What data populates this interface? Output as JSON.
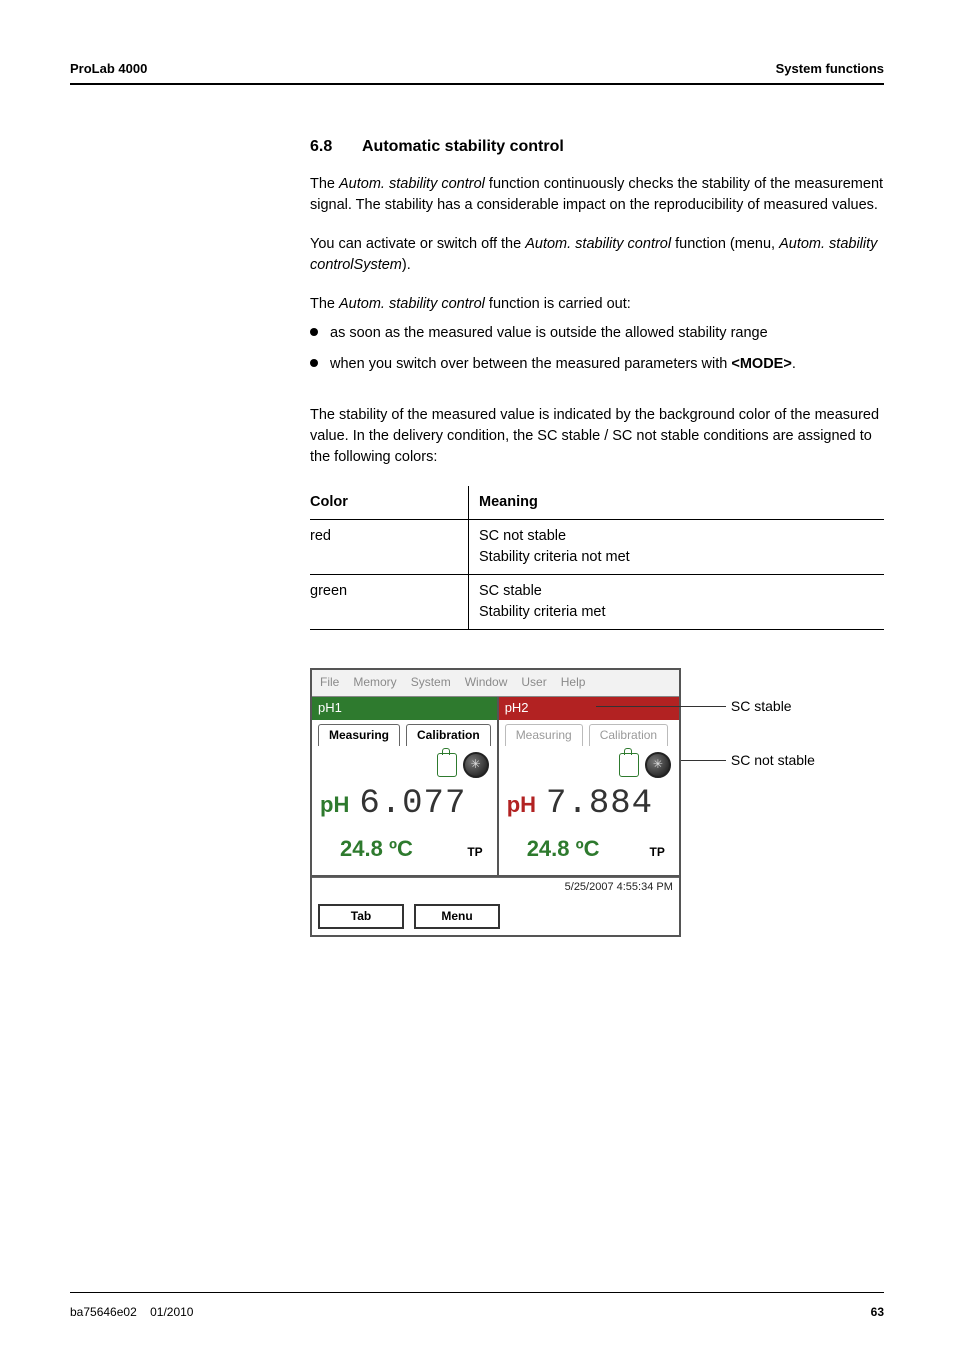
{
  "header": {
    "left": "ProLab 4000",
    "right": "System functions"
  },
  "section": {
    "number": "6.8",
    "title": "Automatic stability control"
  },
  "paragraphs": {
    "p1_a": "The ",
    "p1_b": "Autom. stability control",
    "p1_c": " function continuously checks the stability of the measurement signal. The stability has a considerable impact on the reproducibility of measured values.",
    "p2_a": "You can activate or switch off the ",
    "p2_b": "Autom. stability control",
    "p2_c": " function (menu, ",
    "p2_d": "Autom. stability controlSystem",
    "p2_e": ").",
    "p3_a": "The ",
    "p3_b": "Autom. stability control",
    "p3_c": " function is carried out:",
    "p4": "The stability of the measured value is indicated by the background color of the measured value. In the delivery condition, the SC stable / SC not stable conditions are assigned to the following colors:"
  },
  "bullets": {
    "b1": "as soon as the measured value is outside the allowed stability range",
    "b2_a": "when you switch over between the measured parameters with ",
    "b2_b": "<MODE>",
    "b2_c": "."
  },
  "table": {
    "h1": "Color",
    "h2": "Meaning",
    "r1c1": "red",
    "r1c2a": "SC not stable",
    "r1c2b": "Stability criteria not met",
    "r2c1": "green",
    "r2c2a": "SC stable",
    "r2c2b": "Stability criteria met"
  },
  "device": {
    "menu": {
      "file": "File",
      "memory": "Memory",
      "system": "System",
      "window": "Window",
      "user": "User",
      "help": "Help"
    },
    "pane1": {
      "title": "pH1",
      "tab_measuring": "Measuring",
      "tab_calibration": "Calibration",
      "ph_label": "pH",
      "ph_value": "6.077",
      "temp": "24.8",
      "temp_unit": "ºC",
      "tp": "TP"
    },
    "pane2": {
      "title": "pH2",
      "tab_measuring": "Measuring",
      "tab_calibration": "Calibration",
      "ph_label": "pH",
      "ph_value": "7.884",
      "temp": "24.8",
      "temp_unit": "ºC",
      "tp": "TP"
    },
    "status_time": "5/25/2007 4:55:34 PM",
    "btn_tab": "Tab",
    "btn_menu": "Menu"
  },
  "callouts": {
    "stable": "SC stable",
    "not_stable": "SC not stable"
  },
  "footer": {
    "doc": "ba75646e02",
    "date": "01/2010",
    "page": "63"
  }
}
